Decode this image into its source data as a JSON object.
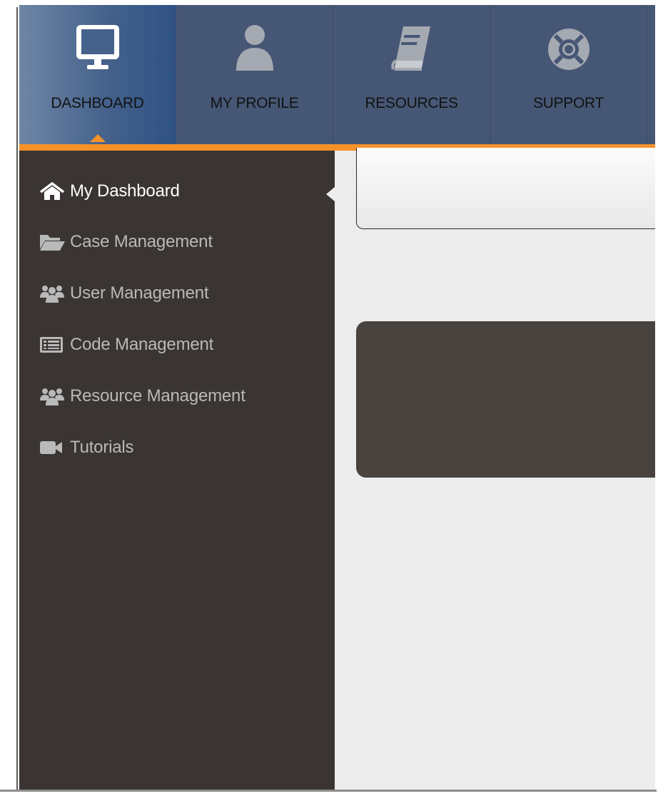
{
  "topnav": {
    "tabs": [
      {
        "label": "DASHBOARD",
        "icon": "monitor-icon",
        "active": true
      },
      {
        "label": "MY PROFILE",
        "icon": "user-icon",
        "active": false
      },
      {
        "label": "RESOURCES",
        "icon": "book-icon",
        "active": false
      },
      {
        "label": "SUPPORT",
        "icon": "life-ring-icon",
        "active": false
      }
    ],
    "accent_color": "#f7922a",
    "bar_color": "#465775"
  },
  "sidebar": {
    "items": [
      {
        "label": "My Dashboard",
        "icon": "home-icon",
        "active": true
      },
      {
        "label": "Case Management",
        "icon": "folder-open-icon",
        "active": false
      },
      {
        "label": "User Management",
        "icon": "users-icon",
        "active": false
      },
      {
        "label": "Code Management",
        "icon": "list-alt-icon",
        "active": false
      },
      {
        "label": "Resource Management",
        "icon": "users-icon",
        "active": false
      },
      {
        "label": "Tutorials",
        "icon": "video-camera-icon",
        "active": false
      }
    ],
    "background_color": "#3a3532"
  }
}
